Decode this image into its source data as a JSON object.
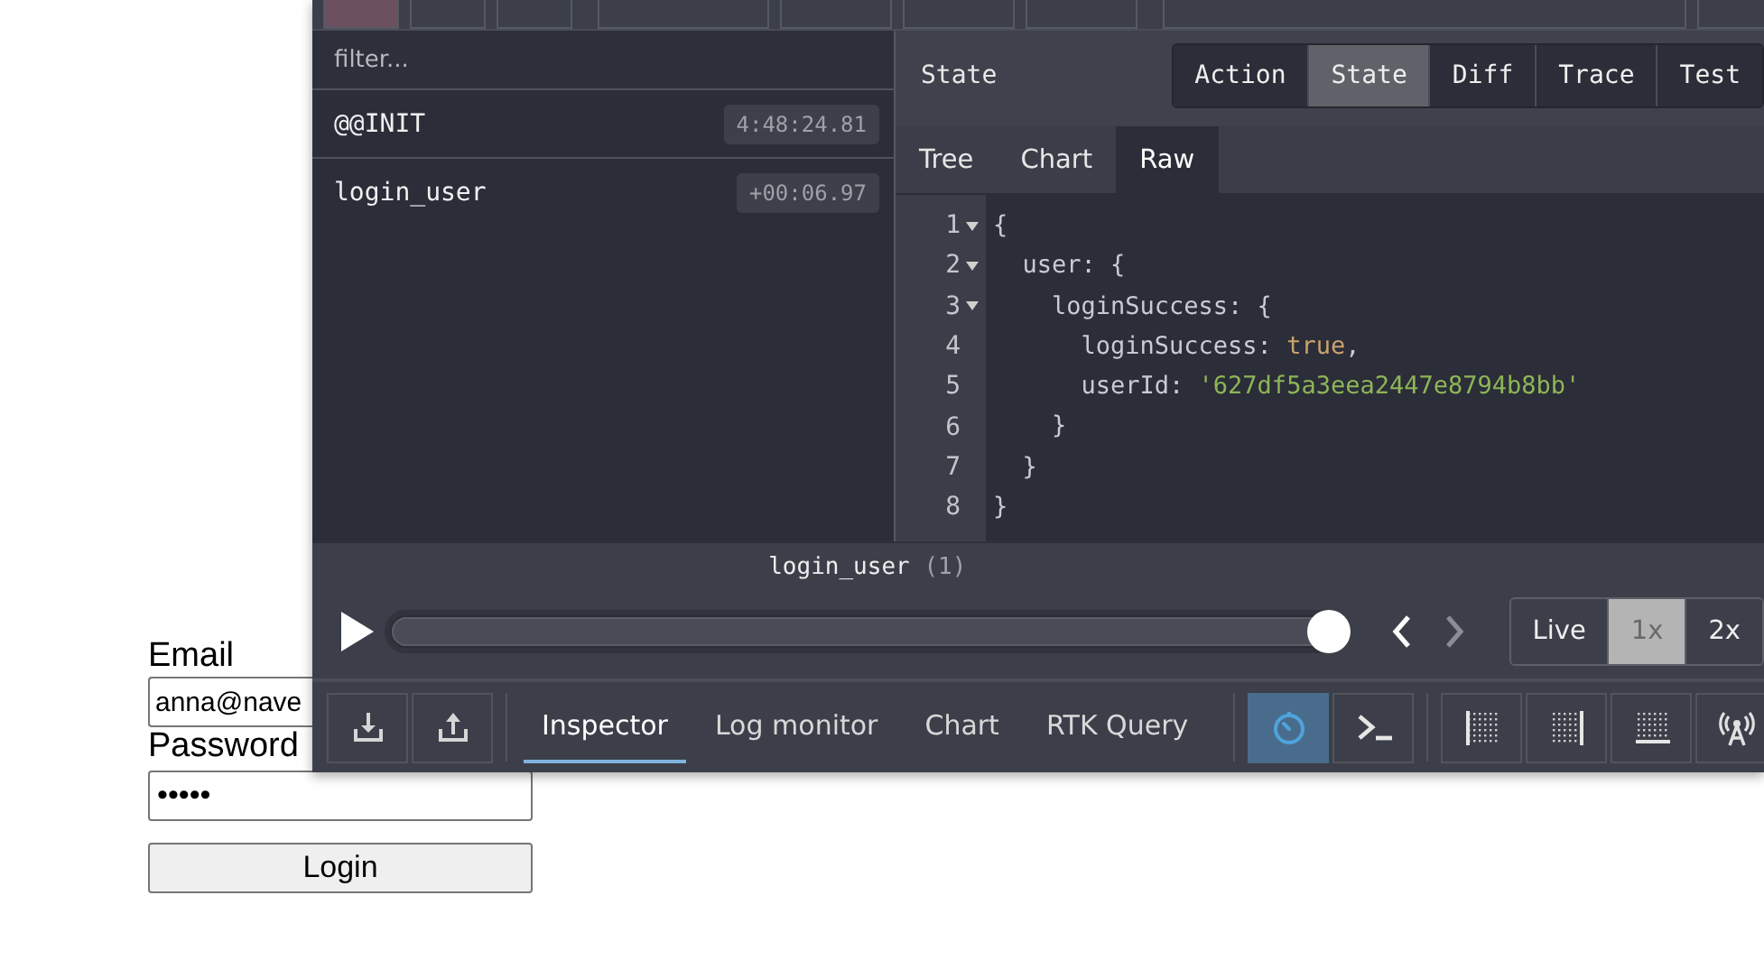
{
  "login_form": {
    "email_label": "Email",
    "email_value": "anna@nave",
    "password_label": "Password",
    "password_value": "•••••",
    "button": "Login"
  },
  "devtools": {
    "filter": {
      "placeholder": "filter..."
    },
    "actions": [
      {
        "name": "@@INIT",
        "time": "4:48:24.81"
      },
      {
        "name": "login_user",
        "time": "+00:06.97"
      }
    ],
    "panel_title": "State",
    "tabs": [
      {
        "label": "Action",
        "selected": false
      },
      {
        "label": "State",
        "selected": true
      },
      {
        "label": "Diff",
        "selected": false
      },
      {
        "label": "Trace",
        "selected": false
      },
      {
        "label": "Test",
        "selected": false
      }
    ],
    "subtabs": [
      {
        "label": "Tree",
        "selected": false
      },
      {
        "label": "Chart",
        "selected": false
      },
      {
        "label": "Raw",
        "selected": true
      }
    ],
    "code_lines": [
      {
        "number": "1",
        "foldable": true,
        "parts": [
          {
            "kind": "plain",
            "text": "{"
          }
        ]
      },
      {
        "number": "2",
        "foldable": true,
        "parts": [
          {
            "kind": "plain",
            "text": "  user: {"
          }
        ]
      },
      {
        "number": "3",
        "foldable": true,
        "parts": [
          {
            "kind": "plain",
            "text": "    loginSuccess: {"
          }
        ]
      },
      {
        "number": "4",
        "foldable": false,
        "parts": [
          {
            "kind": "plain",
            "text": "      loginSuccess: "
          },
          {
            "kind": "bool",
            "text": "true"
          },
          {
            "kind": "plain",
            "text": ","
          }
        ]
      },
      {
        "number": "5",
        "foldable": false,
        "parts": [
          {
            "kind": "plain",
            "text": "      userId: "
          },
          {
            "kind": "string",
            "text": "'627df5a3eea2447e8794b8bb'"
          }
        ]
      },
      {
        "number": "6",
        "foldable": false,
        "parts": [
          {
            "kind": "plain",
            "text": "    }"
          }
        ]
      },
      {
        "number": "7",
        "foldable": false,
        "parts": [
          {
            "kind": "plain",
            "text": "  }"
          }
        ]
      },
      {
        "number": "8",
        "foldable": false,
        "parts": [
          {
            "kind": "plain",
            "text": "}"
          }
        ]
      }
    ],
    "player": {
      "action": "login_user",
      "count": "(1)",
      "level": 1.0,
      "nav": [
        {
          "kind": "prev",
          "disabled": false
        },
        {
          "kind": "next",
          "disabled": true
        }
      ],
      "speeds": [
        {
          "label": "Live",
          "selected": false
        },
        {
          "label": "1x",
          "selected": true
        },
        {
          "label": "2x",
          "selected": false
        }
      ]
    },
    "monitors": [
      {
        "label": "Inspector",
        "selected": true
      },
      {
        "label": "Log monitor",
        "selected": false
      },
      {
        "label": "Chart",
        "selected": false
      },
      {
        "label": "RTK Query",
        "selected": false
      }
    ],
    "toggles": [
      {
        "kind": "clock",
        "on": true
      },
      {
        "kind": "terminal",
        "on": false
      }
    ]
  }
}
